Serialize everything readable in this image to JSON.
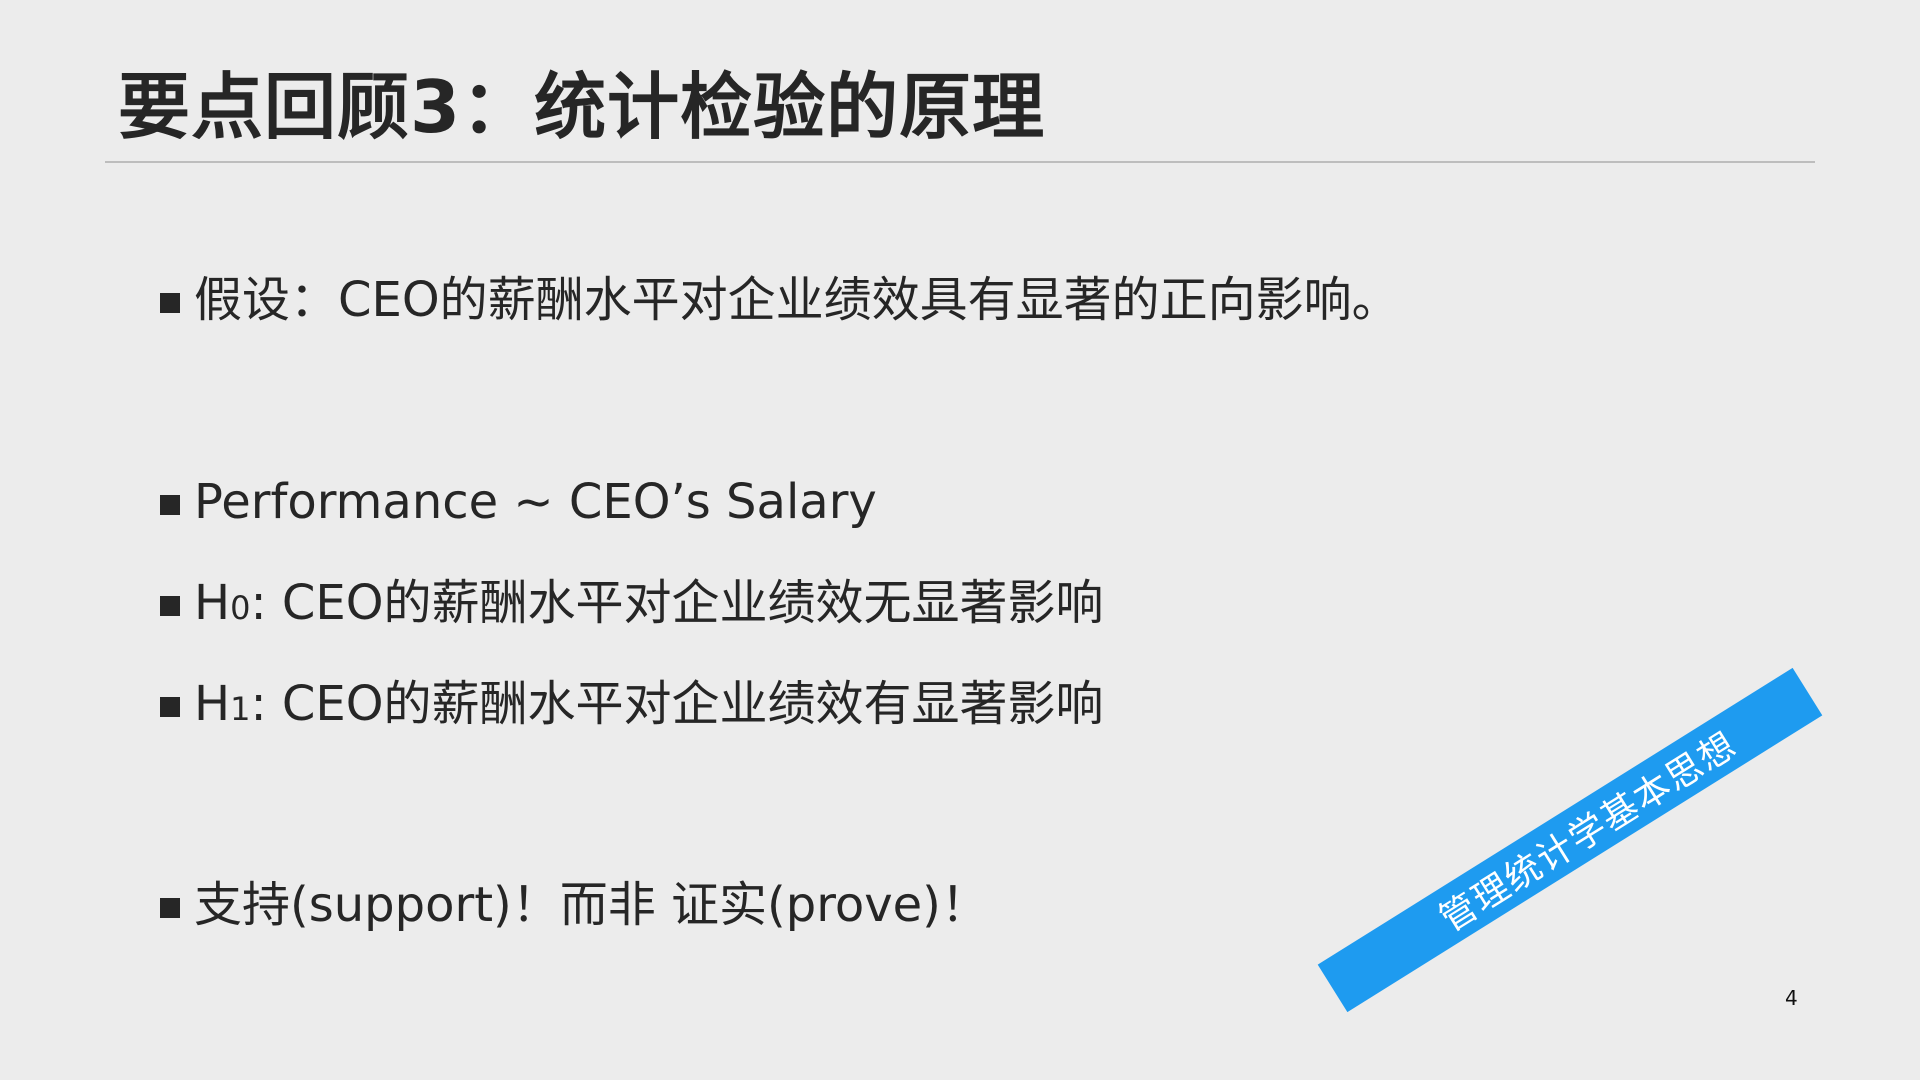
{
  "slide": {
    "title": "要点回顾3：统计检验的原理",
    "bullets": {
      "hypothesis": "假设：CEO的薪酬水平对企业绩效具有显著的正向影响。",
      "model": "Performance ~ CEO’s Salary",
      "h0_letter": "H",
      "h0_sub": "0",
      "h0_text": ": CEO的薪酬水平对企业绩效无显著影响",
      "h1_letter": "H",
      "h1_sub": "1",
      "h1_text": ": CEO的薪酬水平对企业绩效有显著影响",
      "support": "支持(support)！而非 证实(prove)！"
    },
    "ribbon_text": "管理统计学基本思想",
    "page_number": "4"
  },
  "colors": {
    "background": "#ececec",
    "text": "#262626",
    "ribbon": "#1e9bf0",
    "rule": "#bdbdbd"
  }
}
